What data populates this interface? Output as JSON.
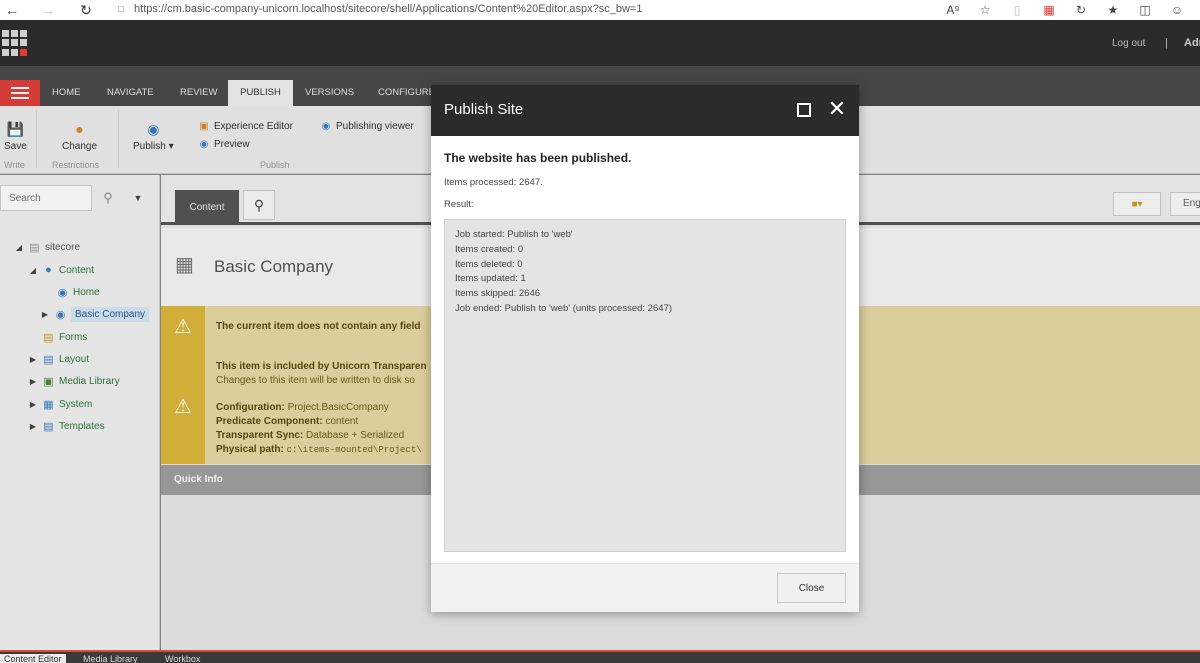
{
  "browser": {
    "url": "https://cm.basic-company-unicorn.localhost/sitecore/shell/Applications/Content%20Editor.aspx?sc_bw=1"
  },
  "header": {
    "logout": "Log out",
    "separator": "|",
    "user": "Adn"
  },
  "ribbon": {
    "tabs": [
      "HOME",
      "NAVIGATE",
      "REVIEW",
      "PUBLISH",
      "VERSIONS",
      "CONFIGURE"
    ],
    "active_tab": "PUBLISH",
    "save_label": "Save",
    "write_group": "Write",
    "change_label": "Change",
    "restrictions_group": "Restrictions",
    "publish_label": "Publish",
    "experience_editor": "Experience Editor",
    "preview": "Preview",
    "publishing_viewer": "Publishing viewer",
    "publish_group": "Publish"
  },
  "sidebar": {
    "search_placeholder": "Search",
    "tree": [
      {
        "label": "sitecore"
      },
      {
        "label": "Content"
      },
      {
        "label": "Home"
      },
      {
        "label": "Basic Company"
      },
      {
        "label": "Forms"
      },
      {
        "label": "Layout"
      },
      {
        "label": "Media Library"
      },
      {
        "label": "System"
      },
      {
        "label": "Templates"
      }
    ]
  },
  "content": {
    "tab_label": "Content",
    "lang": "Eng",
    "item_title": "Basic Company",
    "warning1": "The current item does not contain any field",
    "warning2_title": "This item is included by Unicorn Transparen",
    "warning2_sub": "Changes to this item will be written to disk so",
    "config_label": "Configuration:",
    "config_value": "Project.BasicCompany",
    "predicate_label": "Predicate Component:",
    "predicate_value": "content",
    "sync_label": "Transparent Sync:",
    "sync_value": "Database + Serialized",
    "path_label": "Physical path:",
    "path_value": "c:\\items-mounted\\Project\\",
    "quick_info": "Quick Info"
  },
  "bottom": {
    "tabs": [
      "Content Editor",
      "Media Library",
      "Workbox"
    ]
  },
  "modal": {
    "title": "Publish Site",
    "message": "The website has been published.",
    "items_processed": "Items processed: 2647.",
    "result_label": "Result:",
    "result_lines": [
      "Job started: Publish to 'web'",
      "Items created: 0",
      "Items deleted: 0",
      "Items updated: 1",
      "Items skipped: 2646",
      "Job ended: Publish to 'web' (units processed: 2647)"
    ],
    "close_label": "Close"
  }
}
